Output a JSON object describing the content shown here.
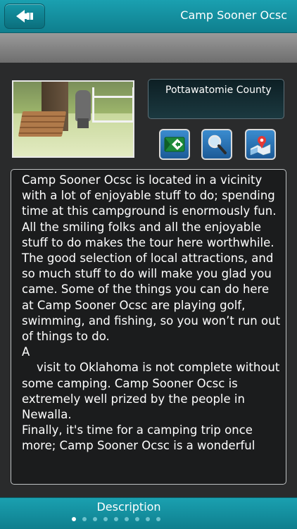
{
  "header": {
    "title": "Camp Sooner Ocsc",
    "back_icon": "back-arrow-icon"
  },
  "location": {
    "county": "Pottawatomie County"
  },
  "actions": [
    {
      "icon": "directions-icon"
    },
    {
      "icon": "search-icon"
    },
    {
      "icon": "map-pin-icon"
    }
  ],
  "description": {
    "text": "Camp Sooner Ocsc is located in a vicinity with a lot of enjoyable stuff to do; spending time at this campground is enormously fun. All the smiling folks and all the enjoyable stuff to do makes the tour here worthwhile.\nThe good selection of local attractions, and so much stuff to do will make you glad you came. Some of the things you can do here at Camp Sooner Ocsc are playing golf, swimming, and fishing, so you won’t run out of things to do.\nA\n    visit to Oklahoma is not complete without some camping. Camp Sooner Ocsc is extremely well prized by the people in Newalla.\nFinally, it's time for a camping trip once more; Camp Sooner Ocsc is a wonderful"
  },
  "footer": {
    "title": "Description",
    "page_count": 9,
    "active_page": 1
  },
  "colors": {
    "accent": "#1497a7",
    "panel_bg": "#1b1c1d",
    "page_bg": "#2a2b2c"
  }
}
